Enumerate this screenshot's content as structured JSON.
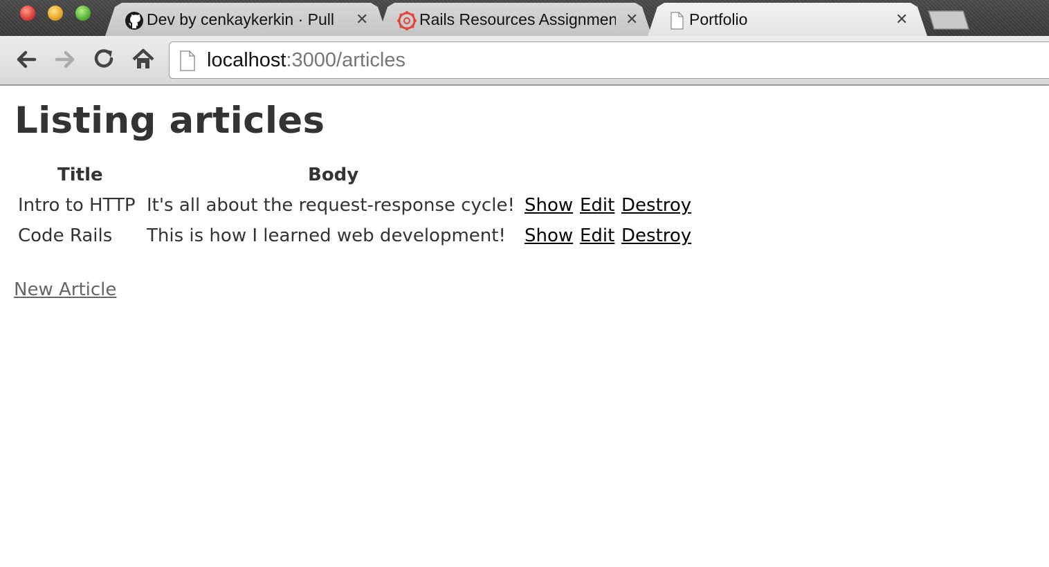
{
  "browser": {
    "tabs": [
      {
        "title": "Dev by cenkaykerkin · Pull",
        "icon": "github-icon"
      },
      {
        "title": "Rails Resources Assignment",
        "icon": "canvas-icon"
      },
      {
        "title": "Portfolio",
        "icon": "page-icon"
      }
    ],
    "address": {
      "host": "localhost",
      "rest": ":3000/articles"
    }
  },
  "page": {
    "heading": "Listing articles",
    "table": {
      "headers": [
        "Title",
        "Body"
      ],
      "rows": [
        {
          "title": "Intro to HTTP",
          "body": "It's all about the request-response cycle!",
          "show": "Show",
          "edit": "Edit",
          "destroy": "Destroy"
        },
        {
          "title": "Code Rails",
          "body": "This is how I learned web development!",
          "show": "Show",
          "edit": "Edit",
          "destroy": "Destroy"
        }
      ]
    },
    "new_link": "New Article"
  }
}
